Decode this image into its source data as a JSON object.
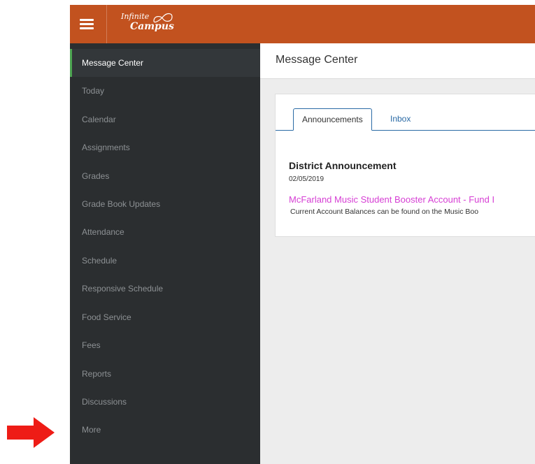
{
  "app": {
    "logo_line1": "Infinite",
    "logo_line2": "Campus",
    "brand_color": "#c2521f",
    "sidebar_color": "#2b2e30",
    "accent_color": "#4ca451",
    "link_color": "#d63fd4",
    "tab_color": "#2a6aa5"
  },
  "icons": {
    "menu": "hamburger-menu-icon",
    "logo": "infinite-campus-logo",
    "annotation": "red-arrow"
  },
  "sidebar": {
    "items": [
      {
        "label": "Message Center",
        "active": true
      },
      {
        "label": "Today"
      },
      {
        "label": "Calendar"
      },
      {
        "label": "Assignments"
      },
      {
        "label": "Grades"
      },
      {
        "label": "Grade Book Updates"
      },
      {
        "label": "Attendance"
      },
      {
        "label": "Schedule"
      },
      {
        "label": "Responsive Schedule"
      },
      {
        "label": "Food Service"
      },
      {
        "label": "Fees"
      },
      {
        "label": "Reports"
      },
      {
        "label": "Discussions"
      },
      {
        "label": "More"
      }
    ]
  },
  "main": {
    "title": "Message Center",
    "tabs": [
      {
        "label": "Announcements",
        "active": true
      },
      {
        "label": "Inbox"
      }
    ],
    "announcement": {
      "title": "District Announcement",
      "date": "02/05/2019",
      "link": "McFarland Music Student Booster Account - Fund I",
      "body": "Current Account Balances can be found on the Music Boo"
    }
  }
}
